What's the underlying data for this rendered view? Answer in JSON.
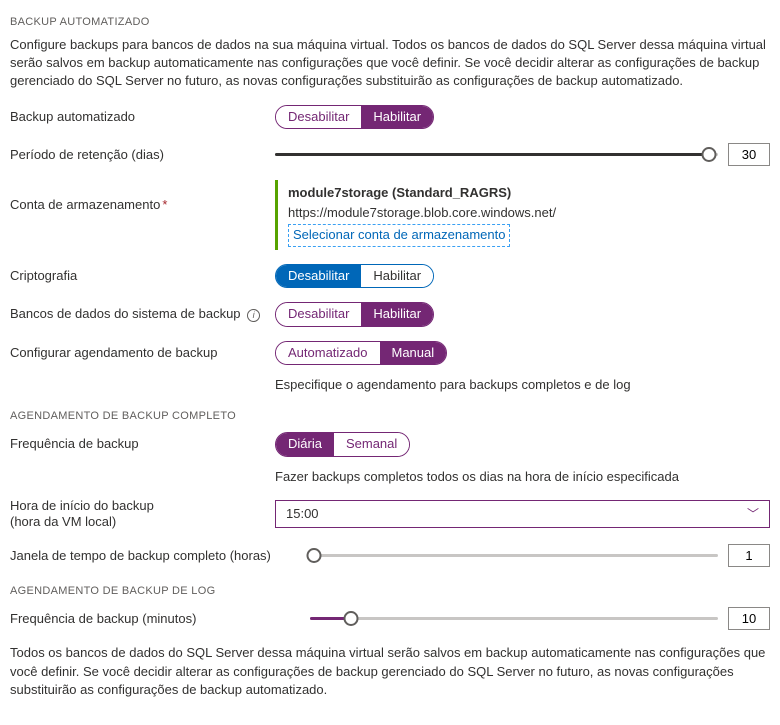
{
  "header": {
    "title": "BACKUP AUTOMATIZADO",
    "description": "Configure backups para bancos de dados na sua máquina virtual. Todos os bancos de dados do SQL Server dessa máquina virtual serão salvos em backup automaticamente nas configurações que você definir. Se você decidir alterar as configurações de backup gerenciado do SQL Server no futuro, as novas configurações substituirão as configurações de backup automatizado."
  },
  "autoBackup": {
    "label": "Backup automatizado",
    "disable": "Desabilitar",
    "enable": "Habilitar"
  },
  "retention": {
    "label": "Período de retenção (dias)",
    "value": "30"
  },
  "storage": {
    "label": "Conta de armazenamento",
    "name": "module7storage (Standard_RAGRS)",
    "url": "https://module7storage.blob.core.windows.net/",
    "select": "Selecionar conta de armazenamento"
  },
  "encryption": {
    "label": "Criptografia",
    "disable": "Desabilitar",
    "enable": "Habilitar"
  },
  "systemDb": {
    "label": "Bancos de dados do sistema de backup",
    "disable": "Desabilitar",
    "enable": "Habilitar"
  },
  "schedule": {
    "label": "Configurar agendamento de backup",
    "auto": "Automatizado",
    "manual": "Manual",
    "helper": "Especifique o agendamento para backups completos e de log"
  },
  "fullSection": {
    "title": "AGENDAMENTO DE BACKUP COMPLETO"
  },
  "frequency": {
    "label": "Frequência de backup",
    "daily": "Diária",
    "weekly": "Semanal",
    "helper": "Fazer backups completos todos os dias na hora de início especificada"
  },
  "startTime": {
    "label1": "Hora de início do backup",
    "label2": "(hora da VM local)",
    "value": "15:00"
  },
  "window": {
    "label": "Janela de tempo de backup completo (horas)",
    "value": "1"
  },
  "logSection": {
    "title": "AGENDAMENTO DE BACKUP DE LOG"
  },
  "logFreq": {
    "label": "Frequência de backup (minutos)",
    "value": "10"
  },
  "footer": {
    "text": "Todos os bancos de dados do SQL Server dessa máquina virtual serão salvos em backup automaticamente nas configurações que você definir. Se você decidir alterar as configurações de backup gerenciado do SQL Server no futuro, as novas configurações substituirão as configurações de backup automatizado."
  }
}
